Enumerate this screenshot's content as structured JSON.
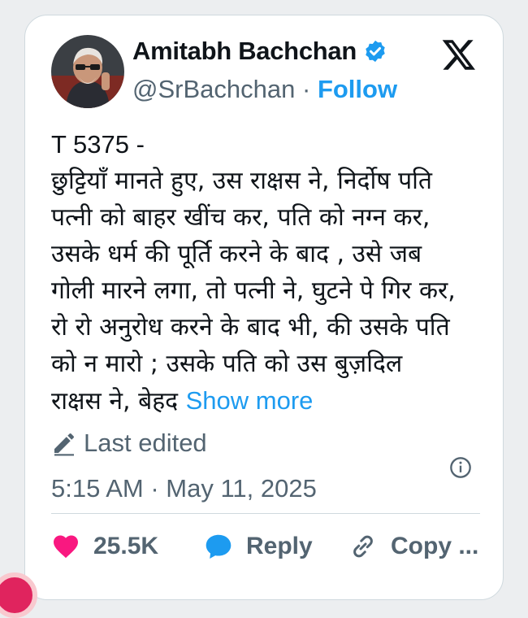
{
  "post": {
    "author_name": "Amitabh Bachchan",
    "handle": "@SrBachchan",
    "separator": "·",
    "follow_label": "Follow",
    "verified_icon": "verified-badge-icon",
    "brand_icon": "x-logo-icon",
    "tweet_id": "T 5375 -",
    "body_lines": [
      " छुट्टियाँ मानते हुए, उस राक्षस ने, निर्दोष पति",
      "पत्नी को बाहर खींच कर, पति को नग्न कर,",
      "उसके धर्म की पूर्ति करने के बाद , उसे जब",
      "गोली मारने लगा, तो पत्नी ने, घुटने पे गिर कर,",
      "रो रो अनुरोध करने के बाद भी, की उसके पति",
      "को न मारो ; उसके पति को उस बुज़दिल",
      "राक्षस ने, बेहद "
    ],
    "show_more_label": "Show more",
    "edited_label": "Last edited",
    "timestamp": "5:15 AM · May 11, 2025",
    "likes": "25.5K",
    "reply_label": "Reply",
    "copy_label": "Copy ..."
  },
  "colors": {
    "accent": "#1d9bf0",
    "like": "#f91880",
    "muted": "#536471",
    "text": "#0f1419"
  }
}
